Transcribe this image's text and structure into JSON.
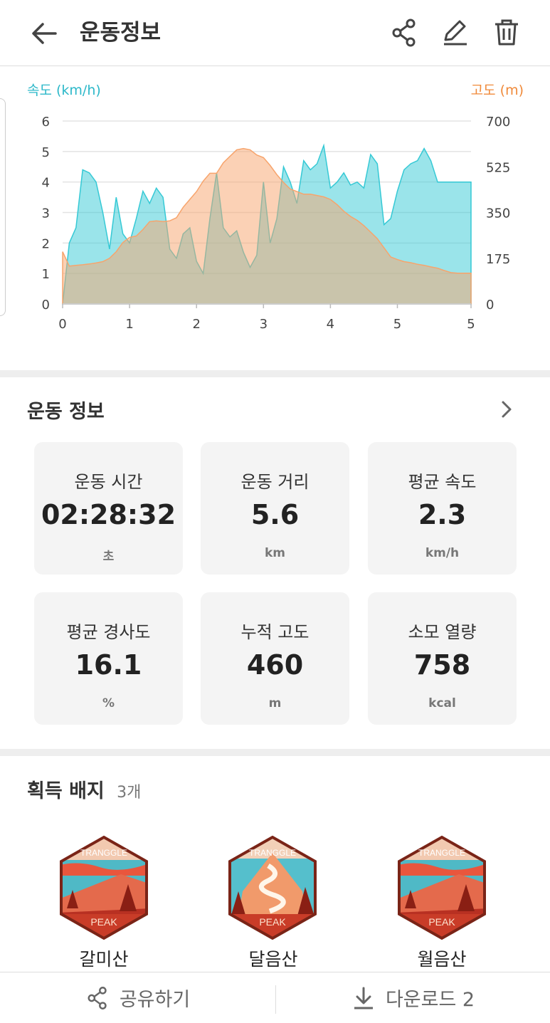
{
  "header": {
    "title": "운동정보"
  },
  "chart_data": {
    "type": "area",
    "left_axis_label": "속도 (km/h)",
    "right_axis_label": "고도 (m)",
    "left_ticks": [
      "0",
      "1",
      "2",
      "3",
      "4",
      "5",
      "6"
    ],
    "right_ticks": [
      "0",
      "175",
      "350",
      "525",
      "700"
    ],
    "x_ticks": [
      "0",
      "1",
      "2",
      "3",
      "4",
      "5",
      "5"
    ],
    "xlim": [
      0,
      6.1
    ],
    "ylim_left": [
      0,
      6
    ],
    "ylim_right": [
      0,
      700
    ],
    "colors": {
      "speed": "#35c9d5",
      "altitude": "#f7a46c"
    },
    "series": [
      {
        "name": "속도 (km/h)",
        "axis": "left",
        "x": [
          0.0,
          0.1,
          0.2,
          0.3,
          0.4,
          0.5,
          0.6,
          0.7,
          0.8,
          0.9,
          1.0,
          1.1,
          1.2,
          1.3,
          1.4,
          1.5,
          1.6,
          1.7,
          1.8,
          1.9,
          2.0,
          2.1,
          2.2,
          2.3,
          2.4,
          2.5,
          2.6,
          2.7,
          2.8,
          2.9,
          3.0,
          3.1,
          3.2,
          3.3,
          3.4,
          3.5,
          3.6,
          3.7,
          3.8,
          3.9,
          4.0,
          4.1,
          4.2,
          4.3,
          4.4,
          4.5,
          4.6,
          4.7,
          4.8,
          4.9,
          5.0,
          5.1,
          5.2,
          5.3,
          5.4,
          5.5,
          5.6,
          5.7,
          5.8,
          5.9,
          6.0,
          6.1
        ],
        "y": [
          0,
          2.0,
          2.5,
          4.4,
          4.3,
          4.0,
          3.0,
          1.8,
          3.5,
          2.3,
          2.0,
          2.8,
          3.7,
          3.3,
          3.8,
          3.5,
          1.8,
          1.5,
          2.3,
          2.5,
          1.4,
          1.0,
          2.8,
          4.3,
          2.5,
          2.2,
          2.4,
          1.7,
          1.2,
          1.6,
          4.0,
          2.0,
          2.8,
          4.5,
          4.0,
          3.3,
          4.7,
          4.4,
          4.6,
          5.2,
          3.8,
          4.0,
          4.3,
          3.9,
          4.0,
          3.8,
          4.9,
          4.6,
          2.6,
          2.8,
          3.7,
          4.4,
          4.6,
          4.7,
          5.1,
          4.7,
          4.0,
          4.0,
          4.0,
          4.0,
          4.0,
          4.0
        ]
      },
      {
        "name": "고도 (m)",
        "axis": "right",
        "x": [
          0.0,
          0.1,
          0.2,
          0.3,
          0.4,
          0.5,
          0.6,
          0.7,
          0.8,
          0.9,
          1.0,
          1.1,
          1.2,
          1.3,
          1.4,
          1.5,
          1.6,
          1.7,
          1.8,
          1.9,
          2.0,
          2.1,
          2.2,
          2.3,
          2.4,
          2.5,
          2.6,
          2.7,
          2.8,
          2.9,
          3.0,
          3.1,
          3.2,
          3.3,
          3.4,
          3.5,
          3.6,
          3.7,
          3.8,
          3.9,
          4.0,
          4.1,
          4.2,
          4.3,
          4.4,
          4.5,
          4.6,
          4.7,
          4.8,
          4.9,
          5.0,
          5.1,
          5.2,
          5.3,
          5.4,
          5.5,
          5.6,
          5.7,
          5.8,
          5.9,
          6.0,
          6.1
        ],
        "y": [
          200,
          145,
          148,
          150,
          153,
          157,
          162,
          175,
          200,
          235,
          255,
          260,
          285,
          315,
          318,
          315,
          318,
          330,
          370,
          400,
          430,
          470,
          500,
          500,
          540,
          565,
          590,
          595,
          590,
          570,
          560,
          530,
          495,
          465,
          440,
          430,
          420,
          420,
          415,
          410,
          400,
          380,
          355,
          335,
          320,
          300,
          275,
          250,
          215,
          180,
          170,
          162,
          158,
          152,
          148,
          142,
          137,
          128,
          120,
          118,
          118,
          118
        ]
      }
    ]
  },
  "exercise": {
    "title": "운동 정보",
    "cards": [
      {
        "label": "운동 시간",
        "value": "02:28:32",
        "unit": "초"
      },
      {
        "label": "운동 거리",
        "value": "5.6",
        "unit": "km"
      },
      {
        "label": "평균 속도",
        "value": "2.3",
        "unit": "km/h"
      },
      {
        "label": "평균 경사도",
        "value": "16.1",
        "unit": "%"
      },
      {
        "label": "누적 고도",
        "value": "460",
        "unit": "m"
      },
      {
        "label": "소모 열량",
        "value": "758",
        "unit": "kcal"
      }
    ]
  },
  "badges": {
    "title": "획득 배지",
    "count": "3개",
    "items": [
      {
        "name": "갈미산",
        "top_text": "TRANGGLE",
        "bottom_text": "PEAK"
      },
      {
        "name": "달음산",
        "top_text": "TRANGGLE",
        "bottom_text": "PEAK"
      },
      {
        "name": "월음산",
        "top_text": "TRANGGLE",
        "bottom_text": "PEAK"
      }
    ]
  },
  "bottom": {
    "share_label": "공유하기",
    "download_label": "다운로드 2"
  }
}
